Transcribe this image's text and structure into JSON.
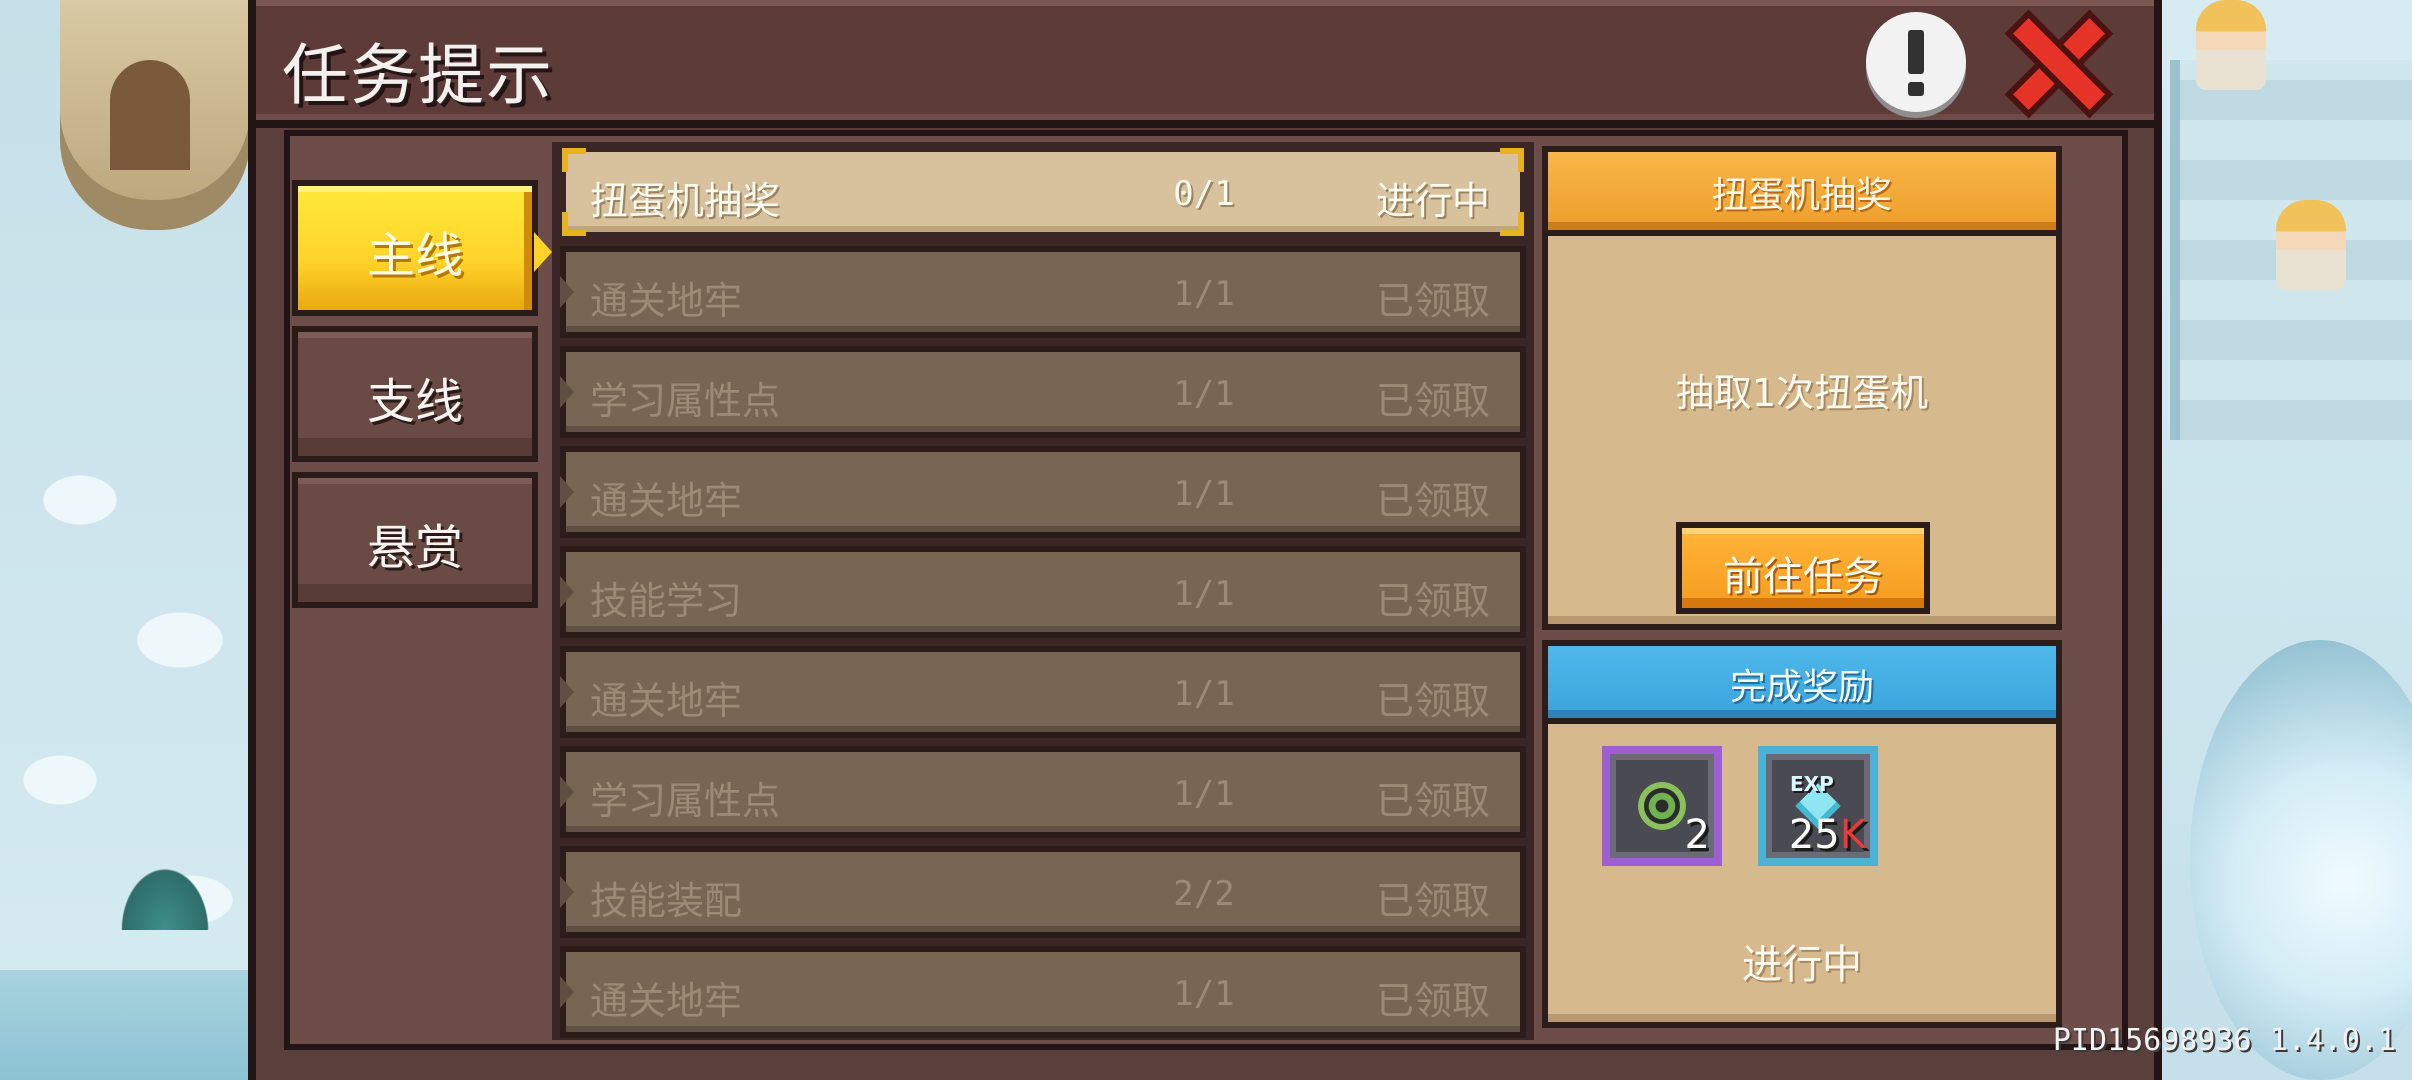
{
  "window": {
    "title": "任务提示"
  },
  "tabs": [
    {
      "label": "主线",
      "active": true
    },
    {
      "label": "支线",
      "active": false
    },
    {
      "label": "悬赏",
      "active": false
    }
  ],
  "tasks": [
    {
      "name": "扭蛋机抽奖",
      "progress": "0/1",
      "status": "进行中",
      "active": true
    },
    {
      "name": "通关地牢",
      "progress": "1/1",
      "status": "已领取",
      "active": false
    },
    {
      "name": "学习属性点",
      "progress": "1/1",
      "status": "已领取",
      "active": false
    },
    {
      "name": "通关地牢",
      "progress": "1/1",
      "status": "已领取",
      "active": false
    },
    {
      "name": "技能学习",
      "progress": "1/1",
      "status": "已领取",
      "active": false
    },
    {
      "name": "通关地牢",
      "progress": "1/1",
      "status": "已领取",
      "active": false
    },
    {
      "name": "学习属性点",
      "progress": "1/1",
      "status": "已领取",
      "active": false
    },
    {
      "name": "技能装配",
      "progress": "2/2",
      "status": "已领取",
      "active": false
    },
    {
      "name": "通关地牢",
      "progress": "1/1",
      "status": "已领取",
      "active": false
    }
  ],
  "detail": {
    "title": "扭蛋机抽奖",
    "description": "抽取1次扭蛋机",
    "go_button": "前往任务"
  },
  "rewards": {
    "title": "完成奖励",
    "items": [
      {
        "icon": "gacha-token-icon",
        "count": "2",
        "unit": "",
        "frame_color": "#9e5fd3"
      },
      {
        "icon": "exp-gem-icon",
        "icon_label": "EXP",
        "count": "25",
        "unit": "K",
        "frame_color": "#4bb2d6"
      }
    ],
    "status": "进行中"
  },
  "footer": {
    "pid": "PID15698936 1.4.0.1"
  },
  "colors": {
    "active_tab": "#ffd42a",
    "detail_header": "#ee9e2b",
    "reward_header": "#3aa3db",
    "close_red": "#e63328"
  }
}
